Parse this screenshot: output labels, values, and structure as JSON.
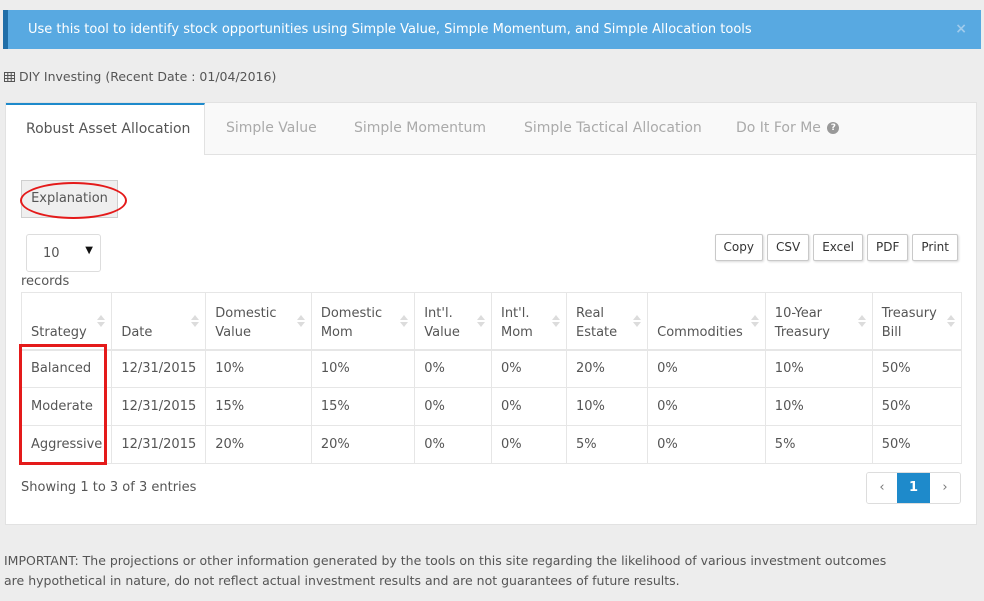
{
  "alert": {
    "message": "Use this tool to identify stock opportunities using Simple Value, Simple Momentum, and Simple Allocation tools",
    "close_label": "×"
  },
  "heading": {
    "icon": "table-grid-icon",
    "text": "DIY Investing (Recent Date : 01/04/2016)"
  },
  "tabs": [
    {
      "label": "Robust Asset Allocation",
      "active": true
    },
    {
      "label": "Simple Value",
      "active": false
    },
    {
      "label": "Simple Momentum",
      "active": false
    },
    {
      "label": "Simple Tactical Allocation",
      "active": false
    },
    {
      "label": "Do It For Me",
      "active": false,
      "icon": "question-circle-icon"
    }
  ],
  "explanation_button": "Explanation",
  "length_select": {
    "value": "10",
    "suffix": "records"
  },
  "export_buttons": [
    "Copy",
    "CSV",
    "Excel",
    "PDF",
    "Print"
  ],
  "table": {
    "columns": [
      "Strategy",
      "Date",
      "Domestic Value",
      "Domestic Mom",
      "Int'l. Value",
      "Int'l. Mom",
      "Real Estate",
      "Commodities",
      "10-Year Treasury",
      "Treasury Bill"
    ],
    "rows": [
      [
        "Balanced",
        "12/31/2015",
        "10%",
        "10%",
        "0%",
        "0%",
        "20%",
        "0%",
        "10%",
        "50%"
      ],
      [
        "Moderate",
        "12/31/2015",
        "15%",
        "15%",
        "0%",
        "0%",
        "10%",
        "0%",
        "10%",
        "50%"
      ],
      [
        "Aggressive",
        "12/31/2015",
        "20%",
        "20%",
        "0%",
        "0%",
        "5%",
        "0%",
        "5%",
        "50%"
      ]
    ]
  },
  "info_text": "Showing 1 to 3 of 3 entries",
  "pagination": {
    "prev": "‹",
    "current": "1",
    "next": "›"
  },
  "disclaimer": "IMPORTANT: The projections or other information generated by the tools on this site regarding the likelihood of various investment outcomes are hypothetical in nature, do not reflect actual investment results and are not guarantees of future results.",
  "colors": {
    "alert_bg": "#58a9e1",
    "alert_border": "#1f6ea8",
    "accent": "#1e8acb",
    "annotation_red": "#e41a1a"
  }
}
